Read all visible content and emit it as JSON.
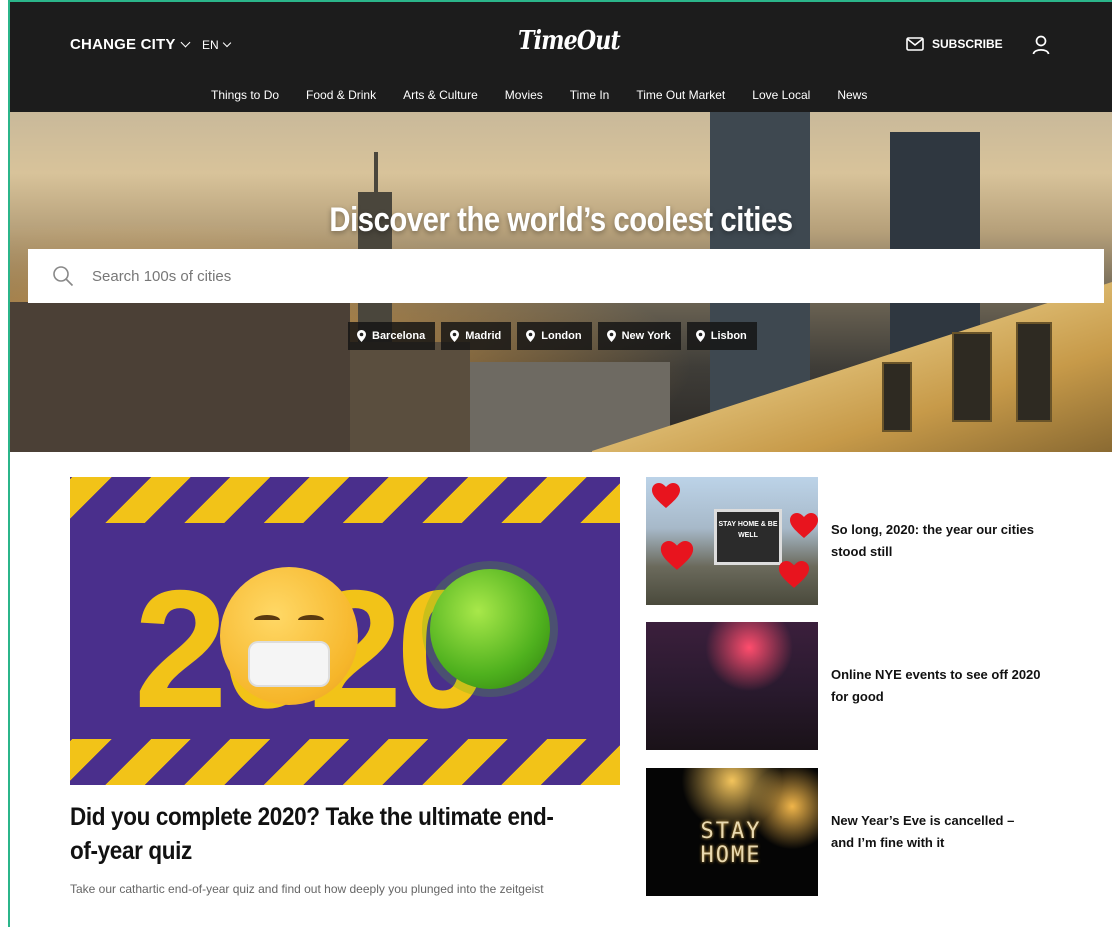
{
  "header": {
    "change_city": "CHANGE CITY",
    "language": "EN",
    "logo": "TimeOut",
    "subscribe": "SUBSCRIBE",
    "nav": [
      "Things to Do",
      "Food & Drink",
      "Arts & Culture",
      "Movies",
      "Time In",
      "Time Out Market",
      "Love Local",
      "News"
    ]
  },
  "hero": {
    "title": "Discover the world’s coolest cities",
    "search_placeholder": "Search 100s of cities",
    "search_value": "",
    "cities": [
      "Barcelona",
      "Madrid",
      "London",
      "New York",
      "Lisbon"
    ]
  },
  "feature": {
    "title": "Did you complete 2020? Take the ultimate end-of-year quiz",
    "description": "Take our cathartic end-of-year quiz and find out how deeply you plunged into the zeitgeist"
  },
  "side_articles": [
    {
      "title": "So long, 2020: the year our cities stood still",
      "marquee": "STAY HOME & BE WELL"
    },
    {
      "title": "Online NYE events to see off 2020 for good"
    },
    {
      "title": "New Year’s Eve is cancelled – and I’m fine with it",
      "image_text": "STAY HOME"
    }
  ],
  "colors": {
    "header_bg": "#1c1c1c",
    "accent_yellow": "#f2c318",
    "purple": "#4a2f8c",
    "border_green": "#2bb58a"
  }
}
